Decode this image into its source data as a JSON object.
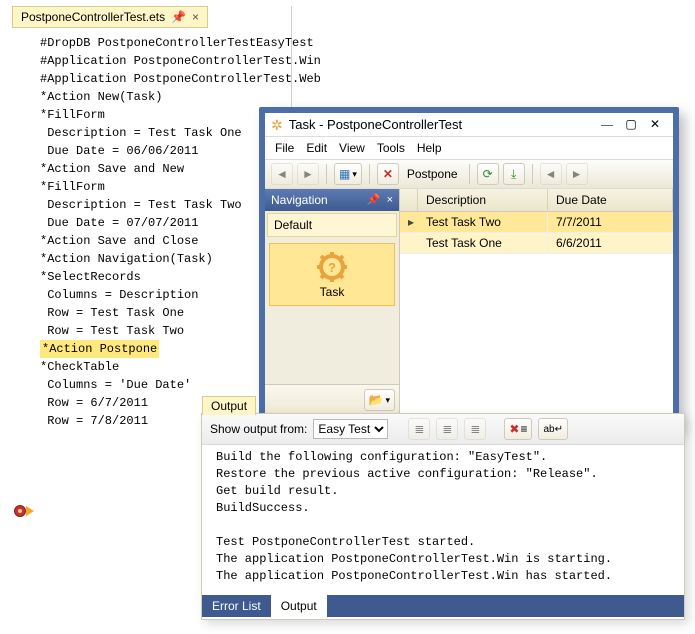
{
  "editor": {
    "tab_name": "PostponeControllerTest.ets",
    "lines": [
      "#DropDB PostponeControllerTestEasyTest",
      "",
      "#Application PostponeControllerTest.Win",
      "#Application PostponeControllerTest.Web",
      "",
      "*Action New(Task)",
      "",
      "*FillForm",
      " Description = Test Task One",
      " Due Date = 06/06/2011",
      "",
      "*Action Save and New",
      "",
      "*FillForm",
      " Description = Test Task Two",
      " Due Date = 07/07/2011",
      "",
      "*Action Save and Close",
      "",
      "*Action Navigation(Task)",
      "",
      "*SelectRecords",
      " Columns = Description",
      " Row = Test Task One",
      " Row = Test Task Two",
      "",
      "*Action Postpone",
      "",
      "*CheckTable",
      " Columns = 'Due Date'",
      " Row = 6/7/2011",
      " Row = 7/8/2011"
    ],
    "highlighted_line_index": 26
  },
  "app": {
    "title": "Task - PostponeControllerTest",
    "menu": [
      "File",
      "Edit",
      "View",
      "Tools",
      "Help"
    ],
    "toolbar": {
      "postpone_label": "Postpone"
    },
    "nav": {
      "header": "Navigation",
      "group": "Default",
      "item": "Task"
    },
    "grid": {
      "columns": [
        "Description",
        "Due Date"
      ],
      "rows": [
        {
          "desc": "Test Task Two",
          "due": "7/7/2011",
          "selected": true
        },
        {
          "desc": "Test Task One",
          "due": "6/6/2011",
          "selected": false
        }
      ]
    }
  },
  "output": {
    "tab": "Output",
    "from_label": "Show output from:",
    "from_value": "Easy Test",
    "lines": [
      "Build the following configuration: \"EasyTest\".",
      "Restore the previous active configuration: \"Release\".",
      "Get build result.",
      "BuildSuccess.",
      "",
      "Test PostponeControllerTest started.",
      "The application PostponeControllerTest.Win is starting.",
      "The application PostponeControllerTest.Win has started."
    ],
    "bottom_tabs": [
      "Error List",
      "Output"
    ],
    "active_bottom_tab": 1
  }
}
